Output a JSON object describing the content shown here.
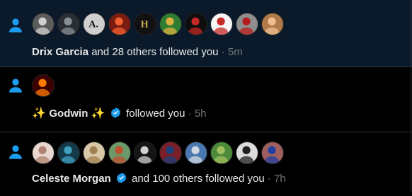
{
  "notifications": [
    {
      "name": "Drix Garcia",
      "text": " and 28 others followed you",
      "time": " · 5m",
      "avatars": [
        {
          "label": "",
          "bg": "#5b5b5b",
          "fg": "#d0d0d0"
        },
        {
          "label": "",
          "bg": "#2a2f36",
          "fg": "#8a8f96"
        },
        {
          "label": "A.",
          "bg": "#cfcfcf",
          "fg": "#111"
        },
        {
          "label": "",
          "bg": "#7a1c10",
          "fg": "#f06030"
        },
        {
          "label": "H",
          "bg": "#111",
          "fg": "#d4a850"
        },
        {
          "label": "",
          "bg": "#2e7d32",
          "fg": "#e0b040"
        },
        {
          "label": "",
          "bg": "#0e0e0e",
          "fg": "#c62828"
        },
        {
          "label": "",
          "bg": "#f5f5f5",
          "fg": "#c62828"
        },
        {
          "label": "",
          "bg": "#8e8e8e",
          "fg": "#b71c1c"
        },
        {
          "label": "",
          "bg": "#b07a4a",
          "fg": "#f0c090"
        }
      ]
    },
    {
      "name_pre": "✨ ",
      "name": "Godwin",
      "name_post": " ✨",
      "text": " followed you",
      "time": " · 5h",
      "avatars": [
        {
          "label": "",
          "bg": "#3b0000",
          "fg": "#ff7a00"
        }
      ]
    },
    {
      "name": "Celeste Morgan",
      "text": " and 100 others followed you",
      "time": " · 7h",
      "avatars": [
        {
          "label": "",
          "bg": "#e8d8d0",
          "fg": "#b08070"
        },
        {
          "label": "",
          "bg": "#143a4a",
          "fg": "#40a0c0"
        },
        {
          "label": "",
          "bg": "#d8c8a8",
          "fg": "#a08050"
        },
        {
          "label": "",
          "bg": "#6d9a6a",
          "fg": "#c05030"
        },
        {
          "label": "",
          "bg": "#151515",
          "fg": "#d0d0d0"
        },
        {
          "label": "",
          "bg": "#7a1f2a",
          "fg": "#1a3f7a"
        },
        {
          "label": "",
          "bg": "#4a78b0",
          "fg": "#d0d8e0"
        },
        {
          "label": "",
          "bg": "#4d8a3a",
          "fg": "#a0c060"
        },
        {
          "label": "",
          "bg": "#dcdcdc",
          "fg": "#202020"
        },
        {
          "label": "",
          "bg": "#a06060",
          "fg": "#2040a0"
        }
      ]
    }
  ],
  "colors": {
    "accent": "#1d9bf0",
    "muted": "#71767b",
    "divider": "#2f3336"
  }
}
